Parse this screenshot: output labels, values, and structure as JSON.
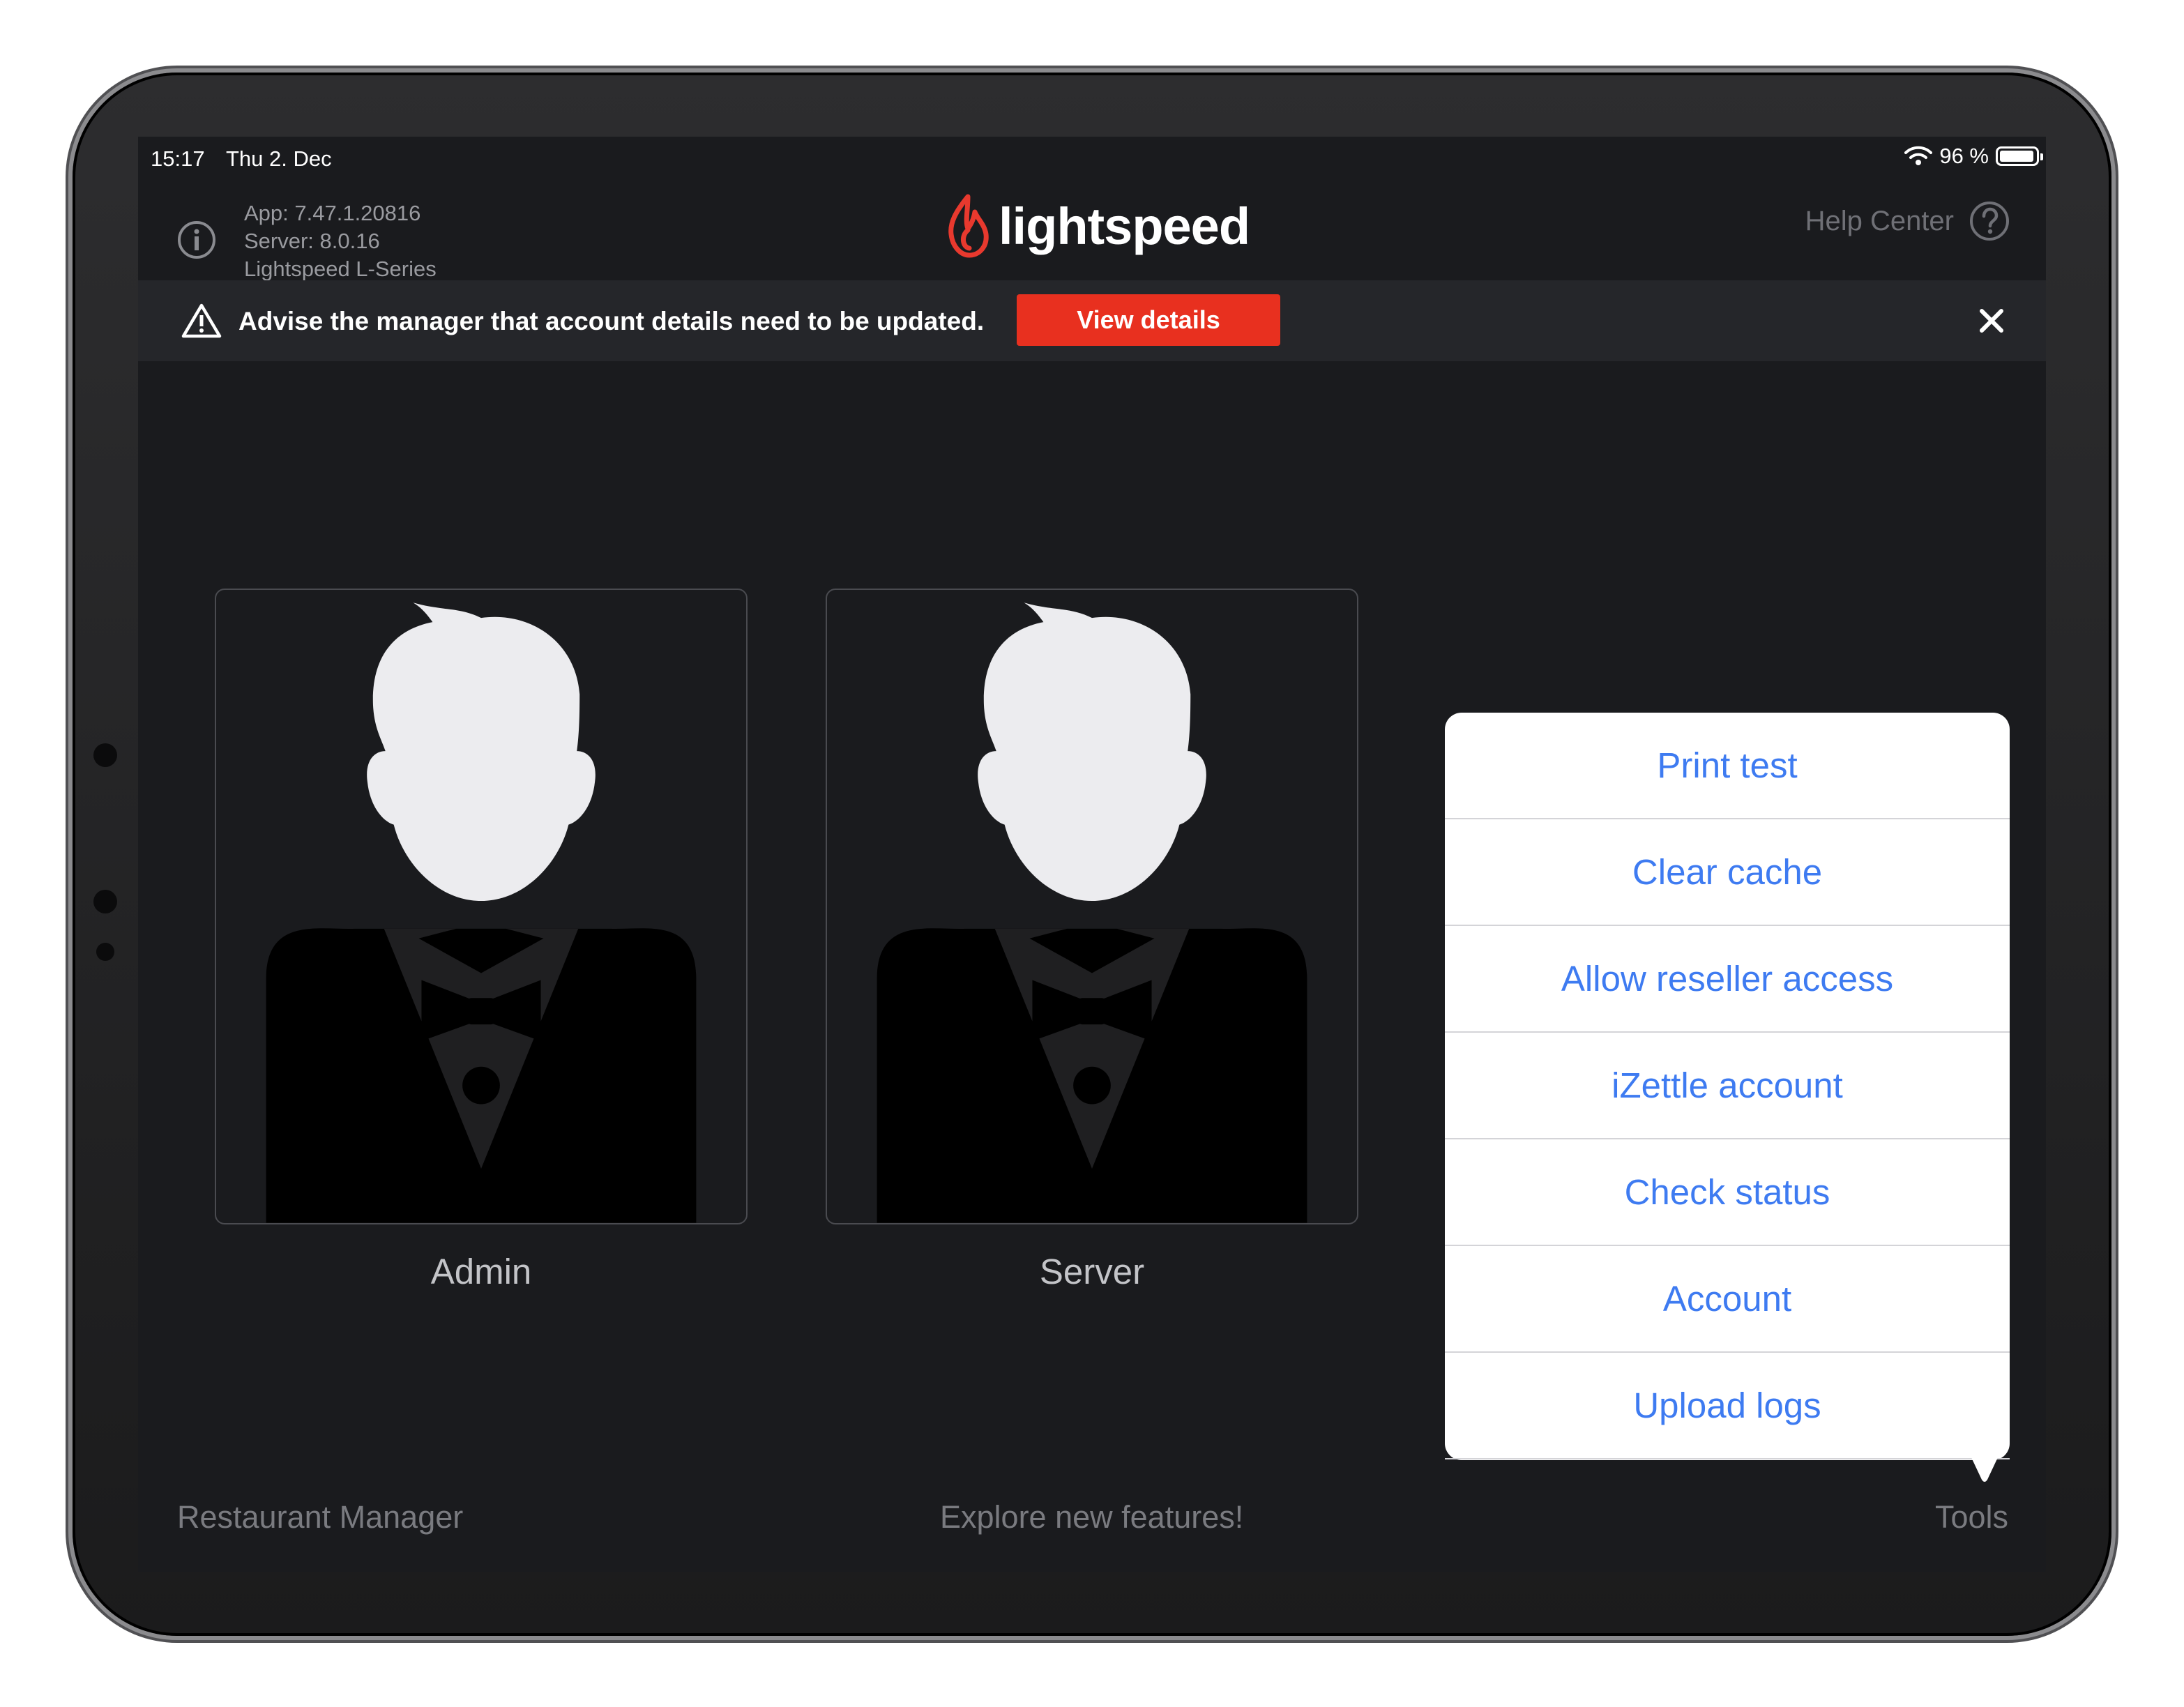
{
  "status_bar": {
    "time": "15:17",
    "date": "Thu 2. Dec",
    "battery": "96 %"
  },
  "header": {
    "app_version": "App: 7.47.1.20816",
    "server_version": "Server: 8.0.16",
    "product": "Lightspeed L-Series",
    "logo_text": "lightspeed",
    "help_label": "Help Center"
  },
  "alert": {
    "message": "Advise the manager that account details need to be updated.",
    "button_label": "View details"
  },
  "users": [
    {
      "name": "Admin"
    },
    {
      "name": "Server"
    }
  ],
  "tools_menu": {
    "items": [
      {
        "label": "Print test"
      },
      {
        "label": "Clear cache"
      },
      {
        "label": "Allow reseller access"
      },
      {
        "label": "iZettle account"
      },
      {
        "label": "Check status"
      },
      {
        "label": "Account"
      },
      {
        "label": "Upload logs"
      }
    ]
  },
  "footer": {
    "left": "Restaurant Manager",
    "center": "Explore new features!",
    "right": "Tools"
  },
  "colors": {
    "accent": "#3e7bf1",
    "alert_button": "#e8301f",
    "logo_flame": "#e8392e",
    "background": "#1a1b1e"
  }
}
